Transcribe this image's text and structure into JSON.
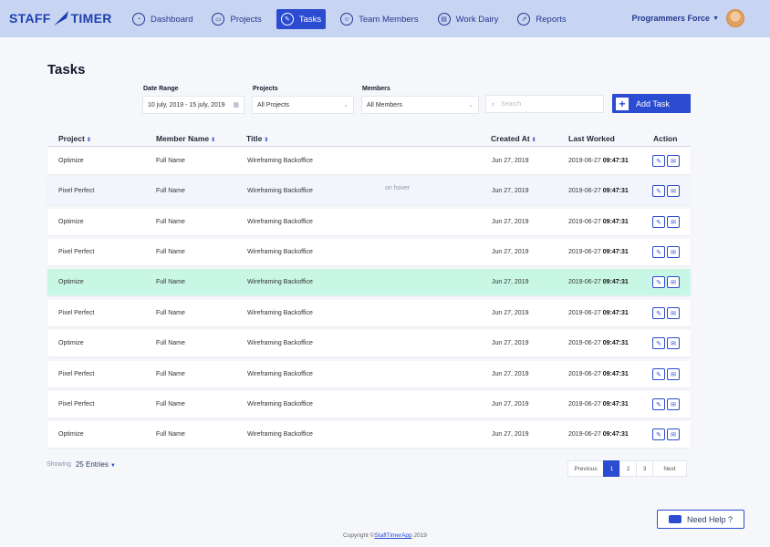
{
  "app": {
    "logo_left": "STAFF",
    "logo_right": "TIMER"
  },
  "nav": {
    "items": [
      {
        "label": "Dashboard",
        "icon": "dashboard-icon"
      },
      {
        "label": "Projects",
        "icon": "projects-icon"
      },
      {
        "label": "Tasks",
        "icon": "tasks-icon",
        "active": true
      },
      {
        "label": "Team Members",
        "icon": "team-icon"
      },
      {
        "label": "Work Dairy",
        "icon": "work-dairy-icon"
      },
      {
        "label": "Reports",
        "icon": "reports-icon"
      }
    ],
    "user": "Programmers Force"
  },
  "page": {
    "title": "Tasks"
  },
  "filters": {
    "date_label": "Date Range",
    "date_value": "10 july, 2019 - 15 july, 2019",
    "projects_label": "Projects",
    "projects_value": "All Projects",
    "members_label": "Members",
    "members_value": "All Members",
    "search_placeholder": "Search",
    "add_task": "Add Task"
  },
  "table": {
    "headers": {
      "project": "Project",
      "member": "Member Name",
      "title": "Title",
      "created": "Created At",
      "last": "Last Worked",
      "action": "Action"
    },
    "hover_note": "on hover",
    "rows": [
      {
        "project": "Optimize",
        "member": "Full Name",
        "title": "Wireframing Backoffice",
        "created": "Jun 27, 2019",
        "date": "2019-06-27",
        "time": "09:47:31"
      },
      {
        "project": "Pixel Perfect",
        "member": "Full Name",
        "title": "Wireframing Backoffice",
        "created": "Jun 27, 2019",
        "date": "2019-06-27",
        "time": "09:47:31"
      },
      {
        "project": "Optimize",
        "member": "Full Name",
        "title": "Wireframing Backoffice",
        "created": "Jun 27, 2019",
        "date": "2019-06-27",
        "time": "09:47:31"
      },
      {
        "project": "Pixel Perfect",
        "member": "Full Name",
        "title": "Wireframing Backoffice",
        "created": "Jun 27, 2019",
        "date": "2019-06-27",
        "time": "09:47:31"
      },
      {
        "project": "Optimize",
        "member": "Full Name",
        "title": "Wireframing Backoffice",
        "created": "Jun 27, 2019",
        "date": "2019-06-27",
        "time": "09:47:31"
      },
      {
        "project": "Pixel Perfect",
        "member": "Full Name",
        "title": "Wireframing Backoffice",
        "created": "Jun 27, 2019",
        "date": "2019-06-27",
        "time": "09:47:31"
      },
      {
        "project": "Optimize",
        "member": "Full Name",
        "title": "Wireframing Backoffice",
        "created": "Jun 27, 2019",
        "date": "2019-06-27",
        "time": "09:47:31"
      },
      {
        "project": "Pixel Perfect",
        "member": "Full Name",
        "title": "Wireframing Backoffice",
        "created": "Jun 27, 2019",
        "date": "2019-06-27",
        "time": "09:47:31"
      },
      {
        "project": "Pixel Perfect",
        "member": "Full Name",
        "title": "Wireframing Backoffice",
        "created": "Jun 27, 2019",
        "date": "2019-06-27",
        "time": "09:47:31"
      },
      {
        "project": "Optimize",
        "member": "Full Name",
        "title": "Wireframing Backoffice",
        "created": "Jun 27, 2019",
        "date": "2019-06-27",
        "time": "09:47:31"
      }
    ]
  },
  "footer": {
    "showing_label": "Showing",
    "entries": "25 Entries",
    "prev": "Previous",
    "pages": [
      "1",
      "2",
      "3"
    ],
    "current_page": "1",
    "next": "Next",
    "help": "Need Help ?",
    "copyright_prefix": "Copyright ©",
    "copyright_link": "StaffTimerApp",
    "copyright_year": " 2019"
  },
  "colors": {
    "accent": "#2b4bd0",
    "topbar": "#c8d5f2",
    "selected_row": "#c9f7e6",
    "hover_row": "#f2f6fc"
  }
}
